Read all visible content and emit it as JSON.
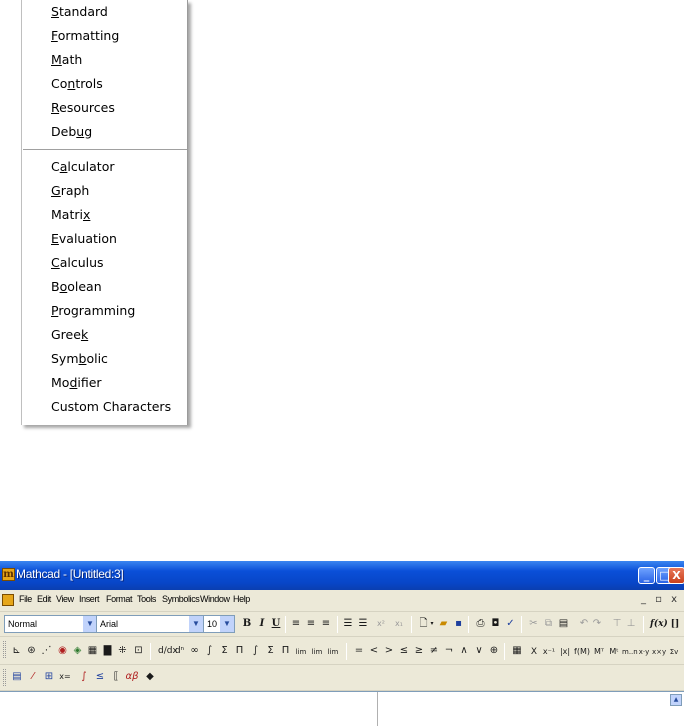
{
  "toolbar_menu": {
    "items": [
      {
        "pre": "",
        "ul": "S",
        "post": "tandard"
      },
      {
        "pre": "",
        "ul": "F",
        "post": "ormatting"
      },
      {
        "pre": "",
        "ul": "M",
        "post": "ath"
      },
      {
        "pre": "Co",
        "ul": "n",
        "post": "trols"
      },
      {
        "pre": "",
        "ul": "R",
        "post": "esources"
      },
      {
        "pre": "Deb",
        "ul": "u",
        "post": "g"
      },
      {
        "pre": "C",
        "ul": "a",
        "post": "lculator"
      },
      {
        "pre": "",
        "ul": "G",
        "post": "raph"
      },
      {
        "pre": "Matri",
        "ul": "x",
        "post": ""
      },
      {
        "pre": "",
        "ul": "E",
        "post": "valuation"
      },
      {
        "pre": "",
        "ul": "C",
        "post": "alculus"
      },
      {
        "pre": "B",
        "ul": "o",
        "post": "olean"
      },
      {
        "pre": "",
        "ul": "P",
        "post": "rogramming"
      },
      {
        "pre": "Gree",
        "ul": "k",
        "post": ""
      },
      {
        "pre": "Sym",
        "ul": "b",
        "post": "olic"
      },
      {
        "pre": "Mo",
        "ul": "d",
        "post": "ifier"
      },
      {
        "pre": "Custom Characters",
        "ul": "",
        "post": ""
      }
    ]
  },
  "window": {
    "title": "Mathcad - [Untitled:3]",
    "controls": {
      "minimize": "_",
      "maximize": "□",
      "close": "X"
    },
    "mdi_controls": "_ ▫ x"
  },
  "menubar": {
    "items": [
      "File",
      "Edit",
      "View",
      "Insert",
      "Format",
      "Tools",
      "Symbolics",
      "Window",
      "Help"
    ]
  },
  "formatting_toolbar": {
    "style_value": "Normal",
    "font_value": "Arial",
    "size_value": "10",
    "bold": "B",
    "italic": "I",
    "underline": "U",
    "superscript": "x²",
    "subscript": "x₁"
  },
  "math_toolbar": {
    "calculus_symbols": [
      "≛",
      "∞",
      "∫",
      "Σ",
      "Π",
      "∫",
      "Σ",
      "Π"
    ],
    "limit_labels": [
      "lim",
      "lim",
      "lim"
    ],
    "boolean_symbols": [
      "=",
      "<",
      ">",
      "≤",
      "≥",
      "≠",
      "¬",
      "∧",
      "∨",
      "⊕"
    ],
    "matrix_labels": [
      "X",
      "x⁻¹",
      "|x|",
      "f(M)",
      "Mᵀ"
    ]
  },
  "colors": {
    "titlebar": "#0a4fd8",
    "toolbar_bg": "#ece9d8",
    "menu_separator": "#a0a0a0"
  }
}
